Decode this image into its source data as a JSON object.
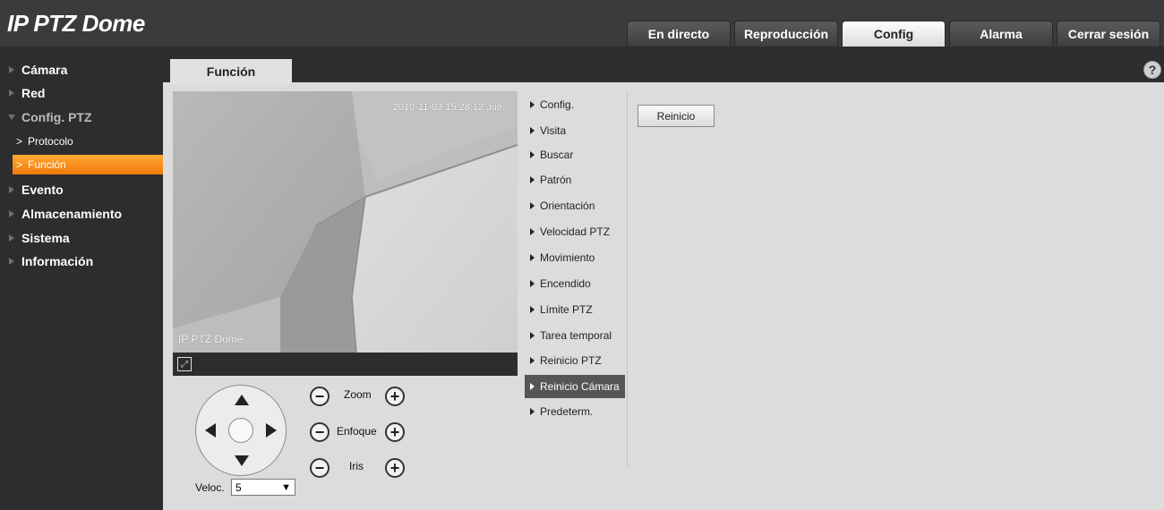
{
  "app": {
    "title": "IP PTZ Dome"
  },
  "topnav": {
    "tabs": [
      {
        "label": "En directo"
      },
      {
        "label": "Reproducción"
      },
      {
        "label": "Config"
      },
      {
        "label": "Alarma"
      },
      {
        "label": "Cerrar sesión"
      }
    ],
    "active": "Config"
  },
  "sidebar": {
    "items": [
      {
        "label": "Cámara"
      },
      {
        "label": "Red"
      },
      {
        "label": "Config. PTZ"
      },
      {
        "label": "Evento"
      },
      {
        "label": "Almacenamiento"
      },
      {
        "label": "Sistema"
      },
      {
        "label": "Información"
      }
    ],
    "sub_items": [
      {
        "label": "Protocolo"
      },
      {
        "label": "Función"
      }
    ],
    "active_sub": "Función",
    "accent": "#f58a14"
  },
  "content": {
    "tab_label": "Función",
    "help_icon": "?"
  },
  "video": {
    "timestamp": "2010-11-03 15:28:12 Jue.",
    "camera_name": "IP PTZ Dome",
    "fullscreen_icon": "fullscreen-icon"
  },
  "ptz": {
    "zoom_label": "Zoom",
    "focus_label": "Enfoque",
    "iris_label": "Iris",
    "minus_symbol": "−",
    "plus_symbol": "+",
    "speed_label": "Veloc.",
    "speed_value": "5",
    "speed_arrow": "▼"
  },
  "function_menu": {
    "items": [
      {
        "label": "Config."
      },
      {
        "label": "Visita"
      },
      {
        "label": "Buscar"
      },
      {
        "label": "Patrón"
      },
      {
        "label": "Orientación"
      },
      {
        "label": "Velocidad PTZ"
      },
      {
        "label": "Movimiento"
      },
      {
        "label": "Encendido"
      },
      {
        "label": "Límite PTZ"
      },
      {
        "label": "Tarea temporal"
      },
      {
        "label": "Reinicio PTZ"
      },
      {
        "label": "Reinicio Cámara"
      },
      {
        "label": "Predeterm."
      }
    ],
    "active": "Reinicio Cámara"
  },
  "panel": {
    "action_button": "Reinicio"
  }
}
